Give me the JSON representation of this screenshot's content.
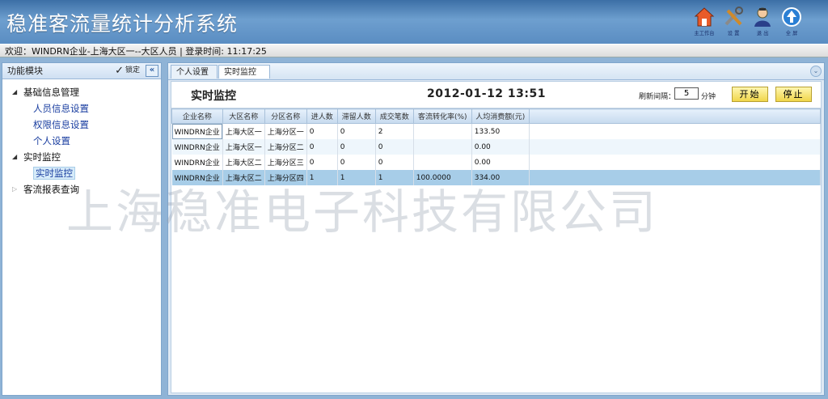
{
  "header": {
    "title": "稳准客流量统计分析系统",
    "icons": [
      {
        "name": "home-icon",
        "label": "主工作台"
      },
      {
        "name": "tools-icon",
        "label": "设 置"
      },
      {
        "name": "user-icon",
        "label": "退 出"
      },
      {
        "name": "up-arrow-icon",
        "label": "全 屏"
      }
    ]
  },
  "welcome": {
    "text": "欢迎：WINDRN企业-上海大区一--大区人员 | 登录时间: 11:17:25"
  },
  "sidebar": {
    "title": "功能模块",
    "lock_label": "锁定",
    "collapse_glyph": "«",
    "items": [
      {
        "label": "基础信息管理",
        "level": 1,
        "expanded": true
      },
      {
        "label": "人员信息设置",
        "level": 2
      },
      {
        "label": "权限信息设置",
        "level": 2
      },
      {
        "label": "个人设置",
        "level": 2
      },
      {
        "label": "实时监控",
        "level": 1,
        "expanded": true
      },
      {
        "label": "实时监控",
        "level": 2,
        "active": true
      },
      {
        "label": "客流报表查询",
        "level": 1,
        "expanded": false
      }
    ]
  },
  "tabs": [
    {
      "label": "个人设置",
      "active": false
    },
    {
      "label": "实时监控",
      "close": "X",
      "active": true
    }
  ],
  "toolbar": {
    "title": "实时监控",
    "datetime": "2012-01-12 13:51",
    "refresh_label": "刷新间隔：",
    "refresh_value": "5",
    "refresh_unit": "分钟",
    "start_label": "开始",
    "stop_label": "停止"
  },
  "table": {
    "columns": [
      "企业名称",
      "大区名称",
      "分区名称",
      "进人数",
      "滞留人数",
      "成交笔数",
      "客流转化率(%)",
      "人均消费额(元)"
    ],
    "rows": [
      [
        "WINDRN企业",
        "上海大区一",
        "上海分区一",
        "0",
        "0",
        "2",
        "",
        "133.50"
      ],
      [
        "WINDRN企业",
        "上海大区一",
        "上海分区二",
        "0",
        "0",
        "0",
        "",
        "0.00"
      ],
      [
        "WINDRN企业",
        "上海大区二",
        "上海分区三",
        "0",
        "0",
        "0",
        "",
        "0.00"
      ],
      [
        "WINDRN企业",
        "上海大区二",
        "上海分区四",
        "1",
        "1",
        "1",
        "100.0000",
        "334.00"
      ]
    ]
  },
  "watermark": "上海稳准电子科技有限公司",
  "colors": {
    "header_blue": "#4f82b8",
    "selected_row": "#a7cde8",
    "button_yellow": "#f0d64a"
  }
}
